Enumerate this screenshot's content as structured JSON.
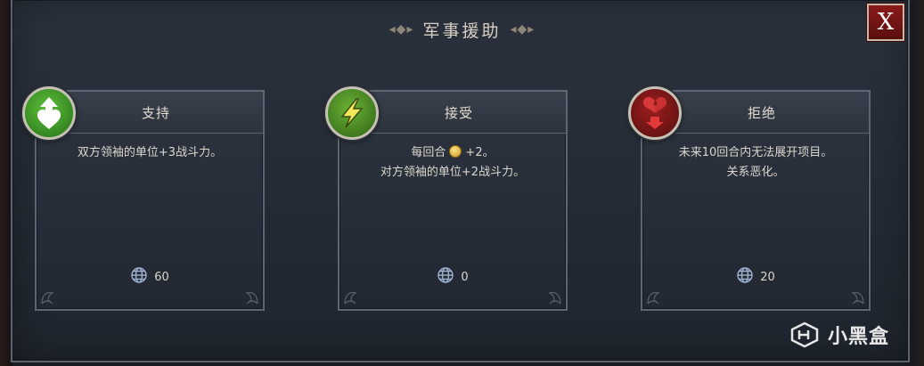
{
  "dialog": {
    "title": "军事援助",
    "close_label": "X"
  },
  "cards": [
    {
      "title": "支持",
      "icon": "support-hearts-icon",
      "badge_color": "#3f9a2a",
      "desc_lines": [
        "双方领袖的单位+3战斗力。"
      ],
      "cost": "60"
    },
    {
      "title": "接受",
      "icon": "lightning-bolt-icon",
      "badge_color": "#4c8a24",
      "desc_before_coin": "每回合",
      "desc_after_coin": "+2。",
      "desc_lines": [
        "对方领袖的单位+2战斗力。"
      ],
      "cost": "0"
    },
    {
      "title": "拒绝",
      "icon": "broken-heart-icon",
      "badge_color": "#7a1616",
      "desc_lines": [
        "未来10回合内无法展开项目。",
        "关系恶化。"
      ],
      "cost": "20"
    }
  ],
  "watermark": {
    "text": "小黑盒"
  }
}
